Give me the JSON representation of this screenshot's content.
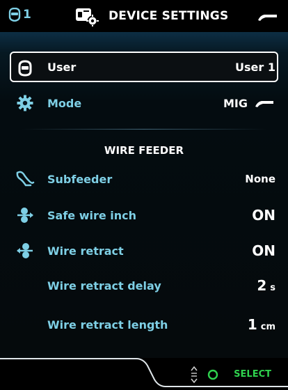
{
  "topbar": {
    "user_number": "1",
    "title": "DEVICE SETTINGS",
    "icons": {
      "user": "welding-helmet-icon",
      "device": "device-settings-icon",
      "torch": "mig-torch-icon"
    }
  },
  "rows": {
    "user": {
      "label": "User",
      "value": "User 1",
      "icon": "welding-helmet-icon"
    },
    "mode": {
      "label": "Mode",
      "value": "MIG",
      "icon": "gear-icon"
    }
  },
  "section": {
    "title": "WIRE FEEDER"
  },
  "wire_feeder": {
    "subfeeder": {
      "label": "Subfeeder",
      "value": "None",
      "icon": "subfeeder-icon"
    },
    "safe_wire_inch": {
      "label": "Safe wire inch",
      "value": "ON",
      "icon": "wire-inch-icon"
    },
    "wire_retract": {
      "label": "Wire retract",
      "value": "ON",
      "icon": "wire-retract-icon"
    },
    "wire_retract_delay": {
      "label": "Wire retract delay",
      "value": "2",
      "unit": "s"
    },
    "wire_retract_length": {
      "label": "Wire retract length",
      "value": "1",
      "unit": "cm"
    }
  },
  "bottombar": {
    "select_label": "SELECT",
    "icons": [
      "scroll-icon",
      "select-circle-icon"
    ]
  },
  "colors": {
    "accent": "#7ecfe5",
    "select": "#2fd24e",
    "panel_top": "#0d2e44"
  }
}
